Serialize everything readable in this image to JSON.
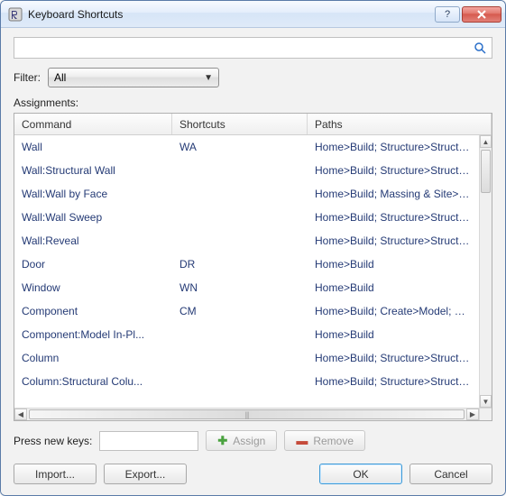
{
  "window": {
    "title": "Keyboard Shortcuts"
  },
  "search": {
    "value": "",
    "placeholder": ""
  },
  "filter": {
    "label": "Filter:",
    "selected": "All"
  },
  "assignments_label": "Assignments:",
  "columns": {
    "command": "Command",
    "shortcuts": "Shortcuts",
    "paths": "Paths"
  },
  "rows": [
    {
      "command": "Wall",
      "shortcut": "WA",
      "path": "Home>Build; Structure>Structure"
    },
    {
      "command": "Wall:Structural Wall",
      "shortcut": "",
      "path": "Home>Build; Structure>Structure"
    },
    {
      "command": "Wall:Wall by Face",
      "shortcut": "",
      "path": "Home>Build; Massing & Site>Co..."
    },
    {
      "command": "Wall:Wall Sweep",
      "shortcut": "",
      "path": "Home>Build; Structure>Structure"
    },
    {
      "command": "Wall:Reveal",
      "shortcut": "",
      "path": "Home>Build; Structure>Structure"
    },
    {
      "command": "Door",
      "shortcut": "DR",
      "path": "Home>Build"
    },
    {
      "command": "Window",
      "shortcut": "WN",
      "path": "Home>Build"
    },
    {
      "command": "Component",
      "shortcut": "CM",
      "path": "Home>Build; Create>Model; Con..."
    },
    {
      "command": "Component:Model In-Pl...",
      "shortcut": "",
      "path": "Home>Build"
    },
    {
      "command": "Column",
      "shortcut": "",
      "path": "Home>Build; Structure>Structure"
    },
    {
      "command": "Column:Structural Colu...",
      "shortcut": "",
      "path": "Home>Build; Structure>Structure"
    }
  ],
  "keys": {
    "label": "Press new keys:",
    "value": ""
  },
  "buttons": {
    "assign": "Assign",
    "remove": "Remove",
    "import": "Import...",
    "export": "Export...",
    "ok": "OK",
    "cancel": "Cancel"
  }
}
